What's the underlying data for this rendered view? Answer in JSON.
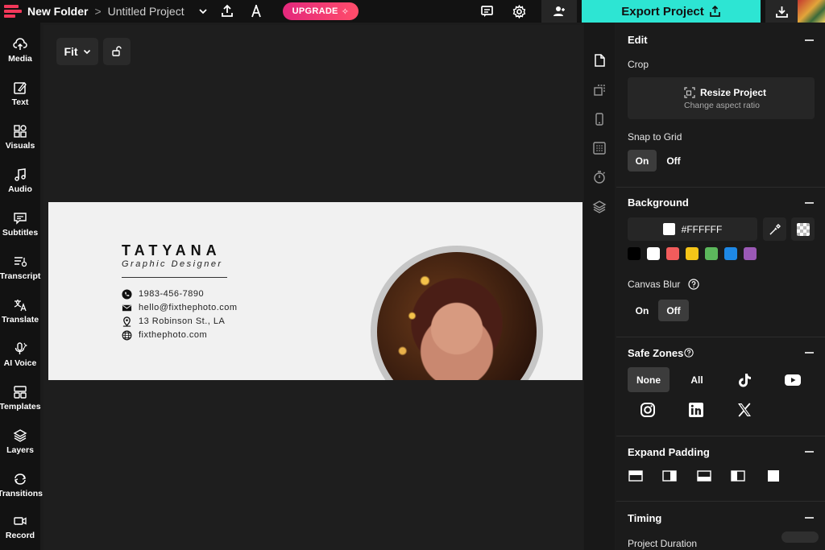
{
  "topbar": {
    "folder": "New Folder",
    "separator": ">",
    "project": "Untitled Project",
    "upgrade_label": "UPGRADE",
    "export_label": "Export Project"
  },
  "sidebar": {
    "items": [
      {
        "label": "Media",
        "icon": "upload-cloud-icon"
      },
      {
        "label": "Text",
        "icon": "text-edit-icon"
      },
      {
        "label": "Visuals",
        "icon": "shapes-icon"
      },
      {
        "label": "Audio",
        "icon": "music-note-icon"
      },
      {
        "label": "Subtitles",
        "icon": "subtitles-icon"
      },
      {
        "label": "Transcript",
        "icon": "transcript-icon"
      },
      {
        "label": "Translate",
        "icon": "translate-icon"
      },
      {
        "label": "AI Voice",
        "icon": "ai-voice-icon"
      },
      {
        "label": "Templates",
        "icon": "templates-icon"
      },
      {
        "label": "Layers",
        "icon": "layers-icon"
      },
      {
        "label": "Transitions",
        "icon": "transitions-icon"
      },
      {
        "label": "Record",
        "icon": "record-camera-icon"
      }
    ]
  },
  "canvas": {
    "fit_label": "Fit",
    "card": {
      "name": "TATYANA",
      "role": "Graphic Designer",
      "phone": "1983-456-7890",
      "email": "hello@fixthephoto.com",
      "address": "13 Robinson St., LA",
      "website": "fixthephoto.com"
    }
  },
  "panel": {
    "edit": {
      "title": "Edit",
      "crop_label": "Crop",
      "resize_title": "Resize Project",
      "resize_sub": "Change aspect ratio",
      "snap_label": "Snap to Grid",
      "snap_on": "On",
      "snap_off": "Off"
    },
    "background": {
      "title": "Background",
      "hex": "#FFFFFF",
      "swatches": [
        "#000000",
        "#FFFFFF",
        "#F25C5C",
        "#F5C518",
        "#5CB85C",
        "#1E88E5",
        "#9B59B6"
      ],
      "blur_label": "Canvas Blur",
      "blur_on": "On",
      "blur_off": "Off"
    },
    "safe_zones": {
      "title": "Safe Zones",
      "none_label": "None",
      "all_label": "All"
    },
    "padding": {
      "title": "Expand Padding"
    },
    "timing": {
      "title": "Timing",
      "duration_label": "Project Duration"
    }
  }
}
